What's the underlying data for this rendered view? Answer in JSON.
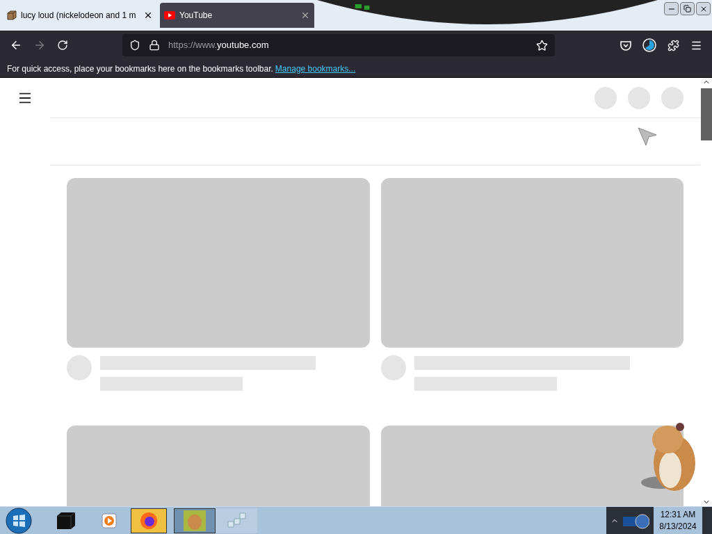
{
  "tabs": [
    {
      "title": "lucy loud (nickelodeon and 1 m",
      "kind": "box",
      "selected": false
    },
    {
      "title": "YouTube",
      "kind": "youtube",
      "selected": true
    }
  ],
  "address_bar": {
    "scheme": "https://www.",
    "domain": "youtube.com"
  },
  "bookmarks_bar": {
    "message": "For quick access, place your bookmarks here on the bookmarks toolbar.",
    "link": "Manage bookmarks..."
  },
  "taskbar": {
    "time": "12:31 AM",
    "date": "8/13/2024"
  }
}
